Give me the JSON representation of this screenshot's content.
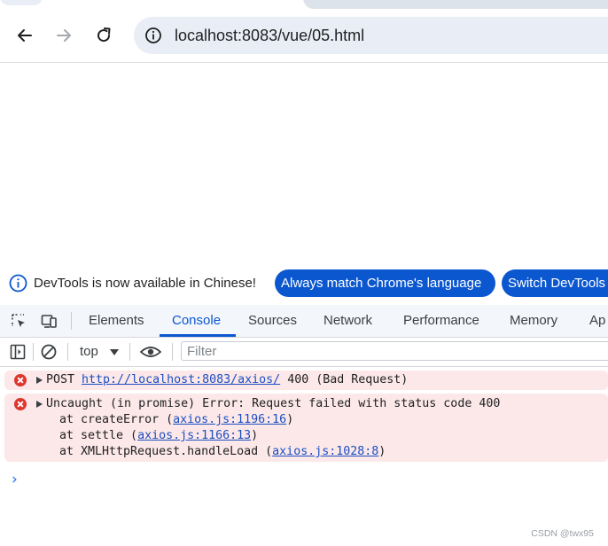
{
  "browser": {
    "url": "localhost:8083/vue/05.html",
    "back_icon": "arrow-left-icon",
    "forward_icon": "arrow-right-icon",
    "reload_icon": "reload-icon",
    "site_info_icon": "info-circle-icon"
  },
  "infobar": {
    "message": "DevTools is now available in Chinese!",
    "match_button": "Always match Chrome's language",
    "switch_button": "Switch DevTools"
  },
  "devtools": {
    "tabs": [
      {
        "label": "Elements"
      },
      {
        "label": "Console"
      },
      {
        "label": "Sources"
      },
      {
        "label": "Network"
      },
      {
        "label": "Performance"
      },
      {
        "label": "Memory"
      },
      {
        "label": "Ap"
      }
    ],
    "active_tab": "Console",
    "accent_color": "#0b57d0"
  },
  "console_toolbar": {
    "context": "top",
    "filter_placeholder": "Filter"
  },
  "messages": {
    "m1": {
      "method": "POST ",
      "url": "http://localhost:8083/axios/",
      "status": " 400 (Bad Request)"
    },
    "m2": {
      "line1": "Uncaught (in promise) Error: Request failed with status code 400",
      "l2_prefix": "at createError (",
      "l2_link": "axios.js:1196:16",
      "l2_suffix": ")",
      "l3_prefix": "at settle (",
      "l3_link": "axios.js:1166:13",
      "l3_suffix": ")",
      "l4_prefix": "at XMLHttpRequest.handleLoad (",
      "l4_link": "axios.js:1028:8",
      "l4_suffix": ")"
    },
    "error_color": "#dc362e",
    "error_bg": "#fce8e8"
  },
  "prompt_symbol": "›",
  "watermark": "CSDN @twx95"
}
